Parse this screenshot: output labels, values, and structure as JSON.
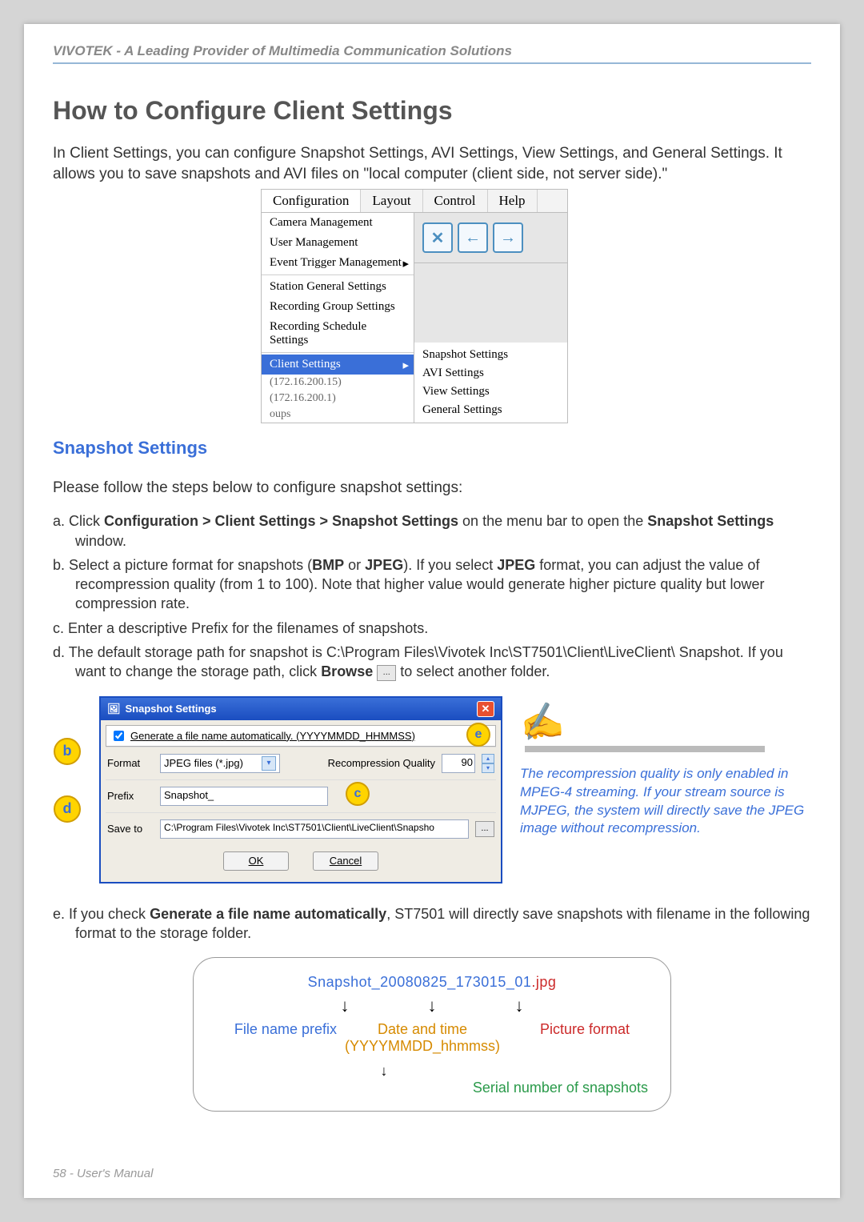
{
  "header": "VIVOTEK - A Leading Provider of Multimedia Communication Solutions",
  "title": "How to Configure Client Settings",
  "intro": "In Client Settings, you can configure Snapshot Settings, AVI Settings, View Settings, and General Settings. It allows you to save snapshots and AVI files on \"local computer (client side, not server side).\"",
  "menubar": [
    "Configuration",
    "Layout",
    "Control",
    "Help"
  ],
  "menu_left": {
    "group1": [
      "Camera Management",
      "User Management",
      "Event Trigger Management"
    ],
    "group2": [
      "Station General Settings",
      "Recording Group Settings",
      "Recording Schedule Settings"
    ],
    "selected": "Client Settings",
    "extras": [
      "(172.16.200.15)",
      "(172.16.200.1)",
      "oups"
    ]
  },
  "menu_right": {
    "buttons": [
      "✕",
      "←",
      "→"
    ],
    "submenu": [
      "Snapshot Settings",
      "AVI Settings",
      "View Settings",
      "General Settings"
    ]
  },
  "section_heading": "Snapshot Settings",
  "steps_intro": "Please follow the steps below to configure snapshot settings:",
  "steps": {
    "a_pre": "a. Click ",
    "a_bold1": "Configuration > Client Settings > Snapshot Settings",
    "a_mid": " on the menu bar to open the ",
    "a_bold2": "Snapshot Settings",
    "a_post": " window.",
    "b_pre": "b. Select a picture format for snapshots (",
    "b_bmp": "BMP",
    "b_or": " or ",
    "b_jpeg": "JPEG",
    "b_mid": "). If you select ",
    "b_jpeg2": "JPEG",
    "b_post": " format, you can adjust the value of recompression quality (from 1 to 100). Note that higher value would generate higher picture quality but lower compression rate.",
    "c": "c. Enter a descriptive Prefix for the filenames of snapshots.",
    "d_pre": "d. The default storage path for snapshot is C:\\Program Files\\Vivotek Inc\\ST7501\\Client\\LiveClient\\ Snapshot. If you want to change the storage path, click ",
    "d_browse": "Browse",
    "d_post": " to select another folder.",
    "e_pre": "e. If you check ",
    "e_bold": "Generate a file name automatically",
    "e_post": ", ST7501 will directly save snapshots with filename in the following format to the storage folder."
  },
  "dialog": {
    "title": "Snapshot Settings",
    "checkbox": "Generate a file name automatically. (YYYYMMDD_HHMMSS)",
    "format_label": "Format",
    "format_value": "JPEG files (*.jpg)",
    "quality_label": "Recompression Quality",
    "quality_value": "90",
    "prefix_label": "Prefix",
    "prefix_value": "Snapshot_",
    "saveto_label": "Save to",
    "saveto_value": "C:\\Program Files\\Vivotek Inc\\ST7501\\Client\\LiveClient\\Snapsho",
    "browse_dots": "...",
    "ok": "OK",
    "cancel": "Cancel"
  },
  "bubbles": {
    "b": "b",
    "c": "c",
    "d": "d",
    "e": "e"
  },
  "tip": "The recompression quality is only enabled in MPEG-4 streaming. If your stream source is MJPEG, the system will directly save the JPEG image without recompression.",
  "filename": {
    "sample_prefix": "Snapshot_",
    "sample_datetime": "20080825_173015_01",
    "sample_ext": ".jpg",
    "label_prefix": "File name prefix",
    "label_date": "Date and time",
    "label_date2": "(YYYYMMDD_hhmmss)",
    "label_format": "Picture format",
    "label_serial": "Serial number of snapshots"
  },
  "footer": "58 - User's Manual"
}
